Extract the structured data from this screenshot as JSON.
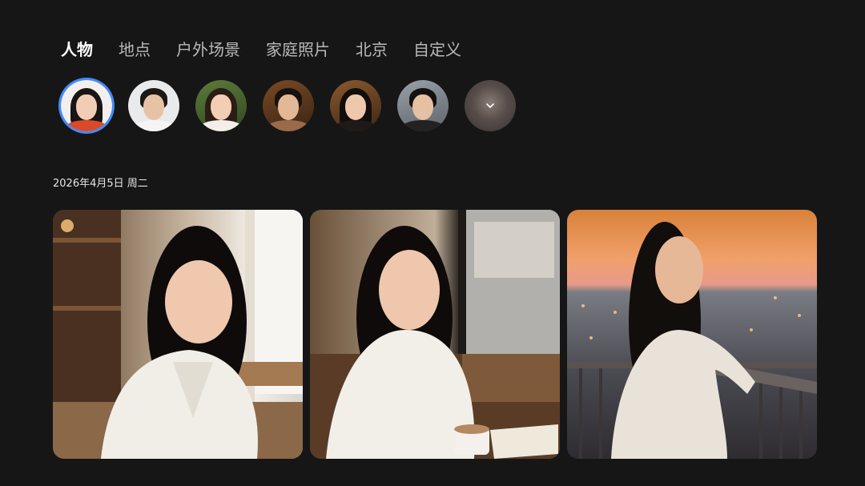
{
  "tabs": [
    {
      "label": "人物",
      "active": true
    },
    {
      "label": "地点",
      "active": false
    },
    {
      "label": "户外场景",
      "active": false
    },
    {
      "label": "家庭照片",
      "active": false
    },
    {
      "label": "北京",
      "active": false
    },
    {
      "label": "自定义",
      "active": false
    }
  ],
  "people": [
    {
      "name": "person-1",
      "selected": true
    },
    {
      "name": "person-2",
      "selected": false
    },
    {
      "name": "person-3",
      "selected": false
    },
    {
      "name": "person-4",
      "selected": false
    },
    {
      "name": "person-5",
      "selected": false
    },
    {
      "name": "person-6",
      "selected": false
    }
  ],
  "more_icon": "chevron-down-icon",
  "date_label": "2026年4月5日 周二",
  "colors": {
    "background": "#161616",
    "selected_ring": "#3f8cff",
    "tab_active": "#ffffff",
    "tab_inactive": "#b9b9b9"
  }
}
